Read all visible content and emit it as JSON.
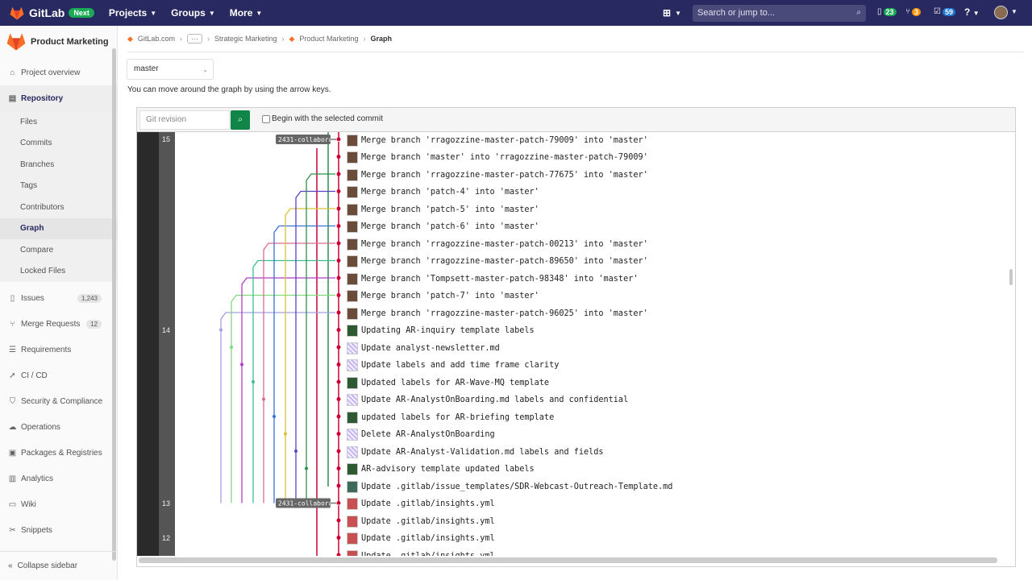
{
  "topnav": {
    "brand": "GitLab",
    "badge": "Next",
    "menus": [
      "Projects",
      "Groups",
      "More"
    ],
    "search_placeholder": "Search or jump to...",
    "issues_count": "23",
    "mr_count": "3",
    "todos_count": "59"
  },
  "sidebar": {
    "project": "Product Marketing",
    "items": [
      {
        "label": "Project overview",
        "icon": "home-icon"
      },
      {
        "label": "Repository",
        "icon": "repository-icon"
      },
      {
        "label": "Issues",
        "icon": "issues-icon",
        "badge": "1,243"
      },
      {
        "label": "Merge Requests",
        "icon": "merge-request-icon",
        "badge": "12"
      },
      {
        "label": "Requirements",
        "icon": "requirements-icon"
      },
      {
        "label": "CI / CD",
        "icon": "rocket-icon"
      },
      {
        "label": "Security & Compliance",
        "icon": "shield-icon"
      },
      {
        "label": "Operations",
        "icon": "cloud-gear-icon"
      },
      {
        "label": "Packages & Registries",
        "icon": "package-icon"
      },
      {
        "label": "Analytics",
        "icon": "chart-icon"
      },
      {
        "label": "Wiki",
        "icon": "book-icon"
      },
      {
        "label": "Snippets",
        "icon": "scissors-icon"
      }
    ],
    "repo_sub": [
      "Files",
      "Commits",
      "Branches",
      "Tags",
      "Contributors",
      "Graph",
      "Compare",
      "Locked Files"
    ],
    "collapse": "Collapse sidebar"
  },
  "breadcrumb": {
    "root": "GitLab.com",
    "group": "Strategic Marketing",
    "project": "Product Marketing",
    "current": "Graph"
  },
  "branch": "master",
  "hint": "You can move around the graph by using the arrow keys.",
  "graph": {
    "revision_placeholder": "Git revision",
    "begin_label": "Begin with the selected commit",
    "ticks": [
      "15",
      "14",
      "13",
      "12"
    ],
    "tag_label": "2431-collaborat…",
    "commits": [
      "Merge branch 'rragozzine-master-patch-79009' into 'master'",
      "Merge branch 'master' into 'rragozzine-master-patch-79009'",
      "Merge branch 'rragozzine-master-patch-77675' into 'master'",
      "Merge branch 'patch-4' into 'master'",
      "Merge branch 'patch-5' into 'master'",
      "Merge branch 'patch-6' into 'master'",
      "Merge branch 'rragozzine-master-patch-00213' into 'master'",
      "Merge branch 'rragozzine-master-patch-89650' into 'master'",
      "Merge branch 'Tompsett-master-patch-98348' into 'master'",
      "Merge branch 'patch-7' into 'master'",
      "Merge branch 'rragozzine-master-patch-96025' into 'master'",
      "Updating AR-inquiry template labels",
      "Update analyst-newsletter.md",
      "Update labels and add time frame clarity",
      "Updated labels for AR-Wave-MQ template",
      "Update AR-AnalystOnBoarding.md labels and confidential",
      "updated labels for AR-briefing template",
      "Delete AR-AnalystOnBoarding",
      "Update AR-Analyst-Validation.md labels and fields",
      "AR-advisory template updated labels",
      "Update .gitlab/issue_templates/SDR-Webcast-Outreach-Template.md",
      "Update .gitlab/insights.yml",
      "Update .gitlab/insights.yml",
      "Update .gitlab/insights.yml",
      "Update .gitlab/insights.yml"
    ],
    "avatars": [
      "photo",
      "photo",
      "photo",
      "photo",
      "photo",
      "photo",
      "photo",
      "photo",
      "photo",
      "photo",
      "photo",
      "green",
      "identicon",
      "identicon",
      "green",
      "identicon",
      "green",
      "identicon",
      "identicon",
      "green",
      "person",
      "red",
      "red",
      "red",
      "red"
    ],
    "lane_colors": [
      "#cc0033",
      "#2d8f4b",
      "#5b3fc4",
      "#d9c23a",
      "#3b6fd4",
      "#d96b8f",
      "#3bbf8f",
      "#b03fc4",
      "#7fd97f",
      "#a0a0e0"
    ]
  }
}
